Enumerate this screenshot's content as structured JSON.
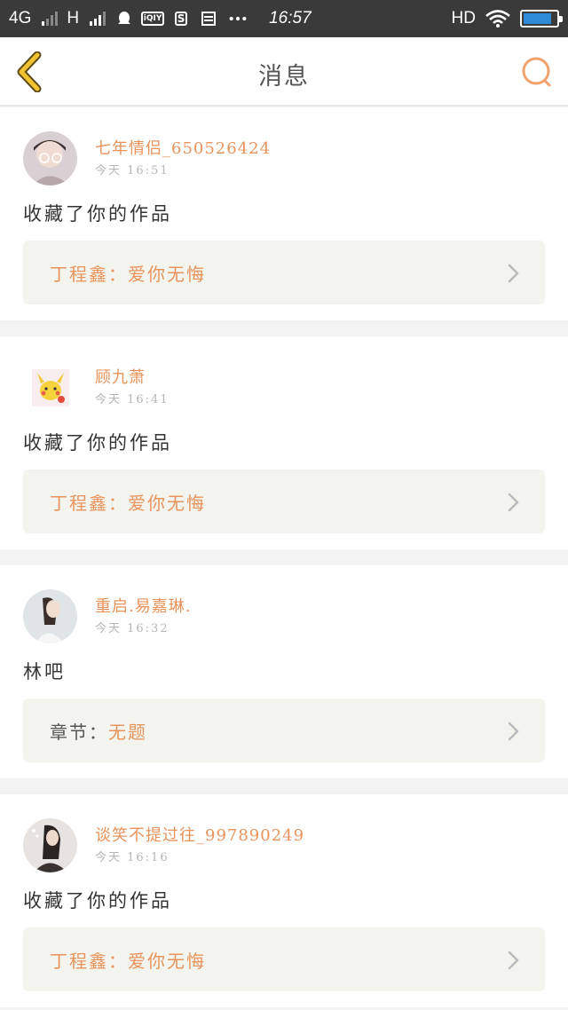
{
  "status_bar": {
    "network_1": "4G",
    "network_2": "H",
    "time": "16:57",
    "hd": "HD",
    "battery_level": 0.85,
    "icons": [
      "signal-icon",
      "qq-icon",
      "iqiyi-icon",
      "s-app-icon",
      "storage-icon",
      "more-dots-icon",
      "wifi-icon",
      "battery-icon"
    ]
  },
  "header": {
    "title": "消息",
    "back_icon": "chevron-left-icon",
    "search_icon": "search-icon"
  },
  "colors": {
    "accent": "#e8935c",
    "back": "#f0b429",
    "work_bg": "#f4f4ef"
  },
  "messages": [
    {
      "username": "七年情侣_650526424",
      "time": "今天  16:51",
      "text": "收藏了你的作品",
      "work_label": "丁程鑫：",
      "work_title": "爱你无悔"
    },
    {
      "username": "顾九萧",
      "time": "今天  16:41",
      "text": "收藏了你的作品",
      "work_label": "丁程鑫：",
      "work_title": "爱你无悔"
    },
    {
      "username": "重启.易嘉琳.",
      "time": "今天  16:32",
      "text": "林吧",
      "work_label": "章节：",
      "work_title": "无题"
    },
    {
      "username": "谈笑不提过往_997890249",
      "time": "今天  16:16",
      "text": "收藏了你的作品",
      "work_label": "丁程鑫：",
      "work_title": "爱你无悔"
    }
  ]
}
